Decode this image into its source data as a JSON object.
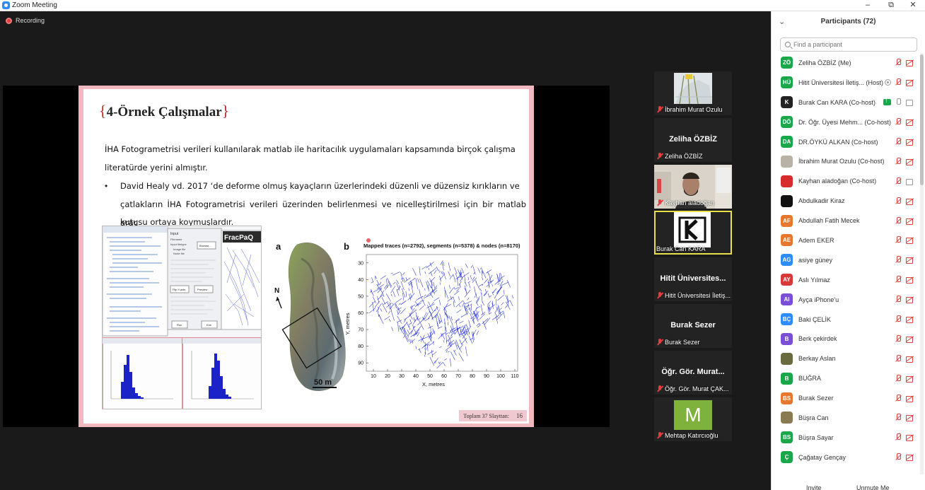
{
  "window": {
    "title": "Zoom Meeting",
    "minimize": "–",
    "restore": "⧉",
    "close": "✕"
  },
  "recording": {
    "label": "Recording"
  },
  "slide": {
    "title": "4-Örnek Çalışmalar",
    "para1_line1": "İHA Fotogrametrisi verileri kullanılarak matlab ile haritacılık uygulamaları kapsamında birçok çalışma",
    "para1_line2": "literatürde yerini almıştır.",
    "bullet_line1": "David Healy vd. 2017 ‘de deforme olmuş kayaçların üzerlerindeki düzenli ve düzensiz kırıkların ve",
    "bullet_line2": "çatlakların İHA Fotogrametrisi verileri üzerinden belirlenmesi ve nicelleştirilmesi için bir matlab araç",
    "bullet_line3": "kutusu ortaya koymuşlardır.",
    "footer_text": "Toplam 37 Slayttan:",
    "footer_page": "16",
    "fig_software_title": "FracPaQ",
    "fig_label_a": "a",
    "fig_label_b": "b",
    "fig_north": "N",
    "fig_scale": "50 m",
    "fig_ui_labels": [
      "Input",
      "Filename",
      "Input filetype",
      "Image file",
      "Node file",
      "Browse...",
      "Flip Y-axis",
      "Preview",
      "Run",
      "Exit"
    ]
  },
  "chart_data": {
    "type": "scatter",
    "title": "Mapped traces (n=2792), segments (n=5378) & nodes (n=8170)",
    "xlabel": "X, metres",
    "ylabel": "Y, metres",
    "xlim": [
      5,
      112
    ],
    "ylim": [
      95,
      25
    ],
    "x_ticks": [
      10,
      20,
      30,
      40,
      50,
      60,
      70,
      80,
      90,
      100,
      110
    ],
    "y_ticks": [
      30,
      40,
      50,
      60,
      70,
      80,
      90
    ],
    "series_color": "#2430d8",
    "region_outline": [
      [
        8,
        38
      ],
      [
        22,
        36
      ],
      [
        30,
        35
      ],
      [
        40,
        32
      ],
      [
        48,
        30
      ],
      [
        56,
        29
      ],
      [
        62,
        28
      ],
      [
        70,
        30
      ],
      [
        80,
        31
      ],
      [
        90,
        33
      ],
      [
        98,
        35
      ],
      [
        104,
        38
      ],
      [
        108,
        44
      ],
      [
        110,
        52
      ],
      [
        106,
        58
      ],
      [
        98,
        62
      ],
      [
        90,
        68
      ],
      [
        82,
        74
      ],
      [
        76,
        80
      ],
      [
        70,
        86
      ],
      [
        62,
        90
      ],
      [
        54,
        90
      ],
      [
        46,
        86
      ],
      [
        38,
        80
      ],
      [
        30,
        74
      ],
      [
        22,
        68
      ],
      [
        14,
        62
      ],
      [
        9,
        54
      ],
      [
        7,
        46
      ]
    ]
  },
  "tiles": [
    {
      "name": "İbrahim Murat Ozulu",
      "big": ""
    },
    {
      "name": "Zeliha ÖZBİZ",
      "big": "Zeliha ÖZBİZ"
    },
    {
      "name": "Kayhan aladoğan",
      "big": ""
    },
    {
      "name": "Burak Can KARA",
      "big": ""
    },
    {
      "name": "Hitit Üniversitesi İletiş...",
      "big": "Hitit Üniversites..."
    },
    {
      "name": "Burak Sezer",
      "big": "Burak Sezer"
    },
    {
      "name": "Öğr. Gör. Murat ÇAK...",
      "big": "Öğr. Gör. Murat..."
    },
    {
      "name": "Mehtap Katırcıoğlu",
      "big": ""
    }
  ],
  "panel": {
    "title": "Participants (72)",
    "search_placeholder": "Find a participant",
    "invite_label": "Invite",
    "unmute_label": "Unmute Me"
  },
  "participants": [
    {
      "initials": "ZÖ",
      "name": "Zeliha ÖZBİZ (Me)",
      "color": "#19a74a",
      "extra": ""
    },
    {
      "initials": "HÜ",
      "name": "Hitit Üniversitesi İletiş... (Host)",
      "color": "#19a74a",
      "extra": "dot"
    },
    {
      "initials": "K",
      "name": "Burak Can KARA (Co-host)",
      "color": "#222222",
      "extra": "share"
    },
    {
      "initials": "DÖ",
      "name": "Dr. Öğr. Üyesi Mehm... (Co-host)",
      "color": "#19a74a",
      "extra": ""
    },
    {
      "initials": "DA",
      "name": "DR.ÖYKÜ ALKAN (Co-host)",
      "color": "#19a74a",
      "extra": ""
    },
    {
      "initials": "",
      "name": "İbrahim Murat Ozulu (Co-host)",
      "color": "#b8b2a6",
      "extra": ""
    },
    {
      "initials": "",
      "name": "Kayhan aladoğan (Co-host)",
      "color": "#d82c2c",
      "extra": "vidon"
    },
    {
      "initials": "",
      "name": "Abdulkadir Kiraz",
      "color": "#111111",
      "extra": ""
    },
    {
      "initials": "AF",
      "name": "Abdullah Fatih Mecek",
      "color": "#e8772e",
      "extra": ""
    },
    {
      "initials": "AE",
      "name": "Adem EKER",
      "color": "#e8772e",
      "extra": ""
    },
    {
      "initials": "AG",
      "name": "asiye güney",
      "color": "#2d8cff",
      "extra": ""
    },
    {
      "initials": "AY",
      "name": "Aslı Yılmaz",
      "color": "#d83a3a",
      "extra": ""
    },
    {
      "initials": "AI",
      "name": "Ayça iPhone'u",
      "color": "#7b4ed6",
      "extra": ""
    },
    {
      "initials": "BÇ",
      "name": "Baki ÇELİK",
      "color": "#2d8cff",
      "extra": ""
    },
    {
      "initials": "B",
      "name": "Berk çekirdek",
      "color": "#7b4ed6",
      "extra": ""
    },
    {
      "initials": "",
      "name": "Berkay Aslan",
      "color": "#6b6b40",
      "extra": ""
    },
    {
      "initials": "B",
      "name": "BUĞRA",
      "color": "#19a74a",
      "extra": ""
    },
    {
      "initials": "BS",
      "name": "Burak Sezer",
      "color": "#e8772e",
      "extra": ""
    },
    {
      "initials": "",
      "name": "Büşra Can",
      "color": "#8a7a52",
      "extra": ""
    },
    {
      "initials": "BS",
      "name": "Büşra Sayar",
      "color": "#19a74a",
      "extra": ""
    },
    {
      "initials": "Ç",
      "name": "Çağatay Gençay",
      "color": "#19a74a",
      "extra": ""
    }
  ]
}
